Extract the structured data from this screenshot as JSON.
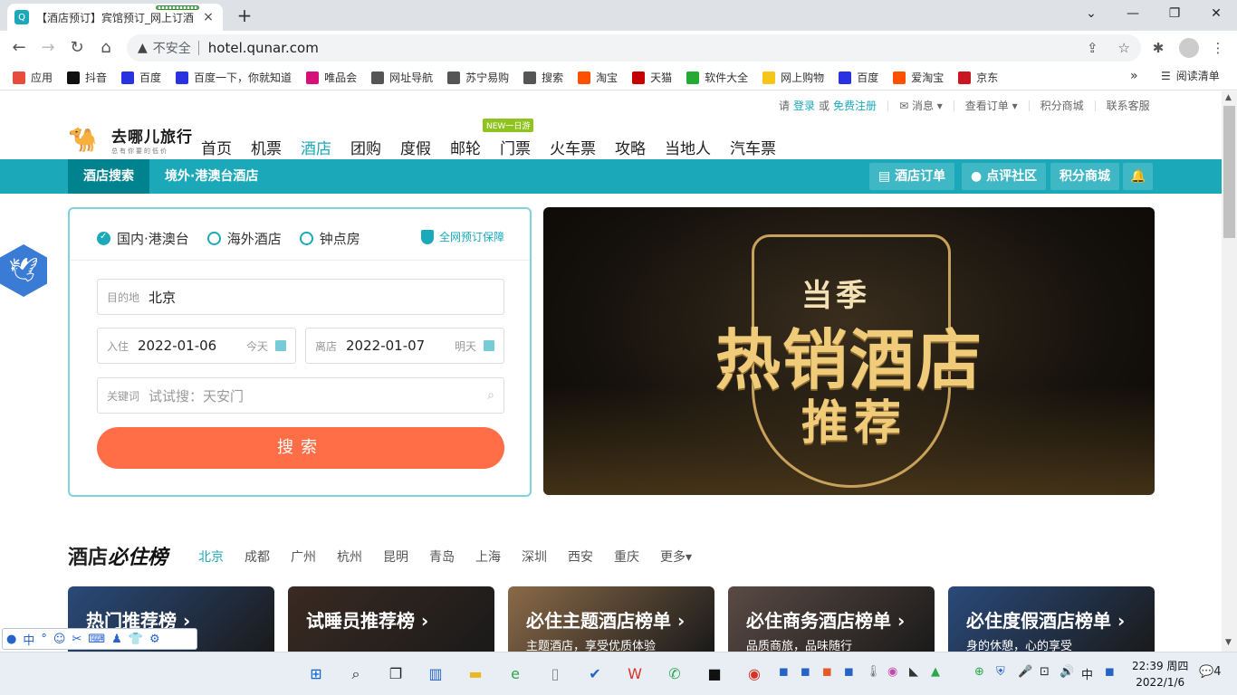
{
  "browser": {
    "tab_title": "【酒店预订】宾馆预订_网上订酒",
    "tab_close": "×",
    "new_tab": "+",
    "win_min": "⌄",
    "win_minimize": "—",
    "win_max": "❐",
    "win_close": "✕",
    "security": "不安全",
    "url": "hotel.qunar.com",
    "bookmarks": [
      {
        "label": "应用",
        "color": "#e74c3c"
      },
      {
        "label": "抖音",
        "color": "#111111"
      },
      {
        "label": "百度",
        "color": "#2932e1"
      },
      {
        "label": "百度一下，你就知道",
        "color": "#2932e1"
      },
      {
        "label": "唯品会",
        "color": "#d6127a"
      },
      {
        "label": "网址导航",
        "color": "#555555"
      },
      {
        "label": "苏宁易购",
        "color": "#555555"
      },
      {
        "label": "搜索",
        "color": "#555555"
      },
      {
        "label": "淘宝",
        "color": "#ff5000"
      },
      {
        "label": "天猫",
        "color": "#c40000"
      },
      {
        "label": "软件大全",
        "color": "#22aa33"
      },
      {
        "label": "网上购物",
        "color": "#f5c518"
      },
      {
        "label": "百度",
        "color": "#2932e1"
      },
      {
        "label": "爱淘宝",
        "color": "#ff5000"
      },
      {
        "label": "京东",
        "color": "#c81623"
      }
    ],
    "bookmarks_more": "»",
    "reading_list": "阅读清单"
  },
  "userbar": {
    "prefix": "请",
    "login": "登录",
    "or": "或",
    "register": "免费注册",
    "messages": "消息",
    "orders": "查看订单",
    "points_mall": "积分商城",
    "service": "联系客服"
  },
  "logo": {
    "name": "去哪儿旅行",
    "slogan": "总有你要的低价"
  },
  "nav": {
    "items": [
      "首页",
      "机票",
      "酒店",
      "团购",
      "度假",
      "邮轮",
      "门票",
      "火车票",
      "攻略",
      "当地人",
      "汽车票"
    ],
    "active_index": 2,
    "badge_new": "NEW",
    "badge_text": "一日游"
  },
  "subnav": {
    "active": "酒店搜索",
    "overseas": "境外·港澳台酒店",
    "right": [
      "酒店订单",
      "点评社区",
      "积分商城"
    ]
  },
  "search": {
    "options": [
      "国内·港澳台",
      "海外酒店",
      "钟点房"
    ],
    "selected_index": 0,
    "guarantee": "全网预订保障",
    "dest_label": "目的地",
    "dest_value": "北京",
    "checkin_label": "入住",
    "checkin_value": "2022-01-06",
    "checkin_hint": "今天",
    "checkout_label": "离店",
    "checkout_value": "2022-01-07",
    "checkout_hint": "明天",
    "keyword_label": "关键词",
    "keyword_placeholder": "试试搜：天安门",
    "button": "搜索"
  },
  "banner": {
    "line1": "当季",
    "line2": "热销酒店",
    "line3": "推荐"
  },
  "ranking": {
    "title_a": "酒店",
    "title_b": "必住榜",
    "cities": [
      "北京",
      "成都",
      "广州",
      "杭州",
      "昆明",
      "青岛",
      "上海",
      "深圳",
      "西安",
      "重庆",
      "更多▾"
    ],
    "active_city_index": 0,
    "cards": [
      {
        "title": "热门推荐榜 ›",
        "sub": "",
        "bg": "#2a4a7a"
      },
      {
        "title": "试睡员推荐榜 ›",
        "sub": "",
        "bg": "#3a2a22"
      },
      {
        "title": "必住主题酒店榜单 ›",
        "sub": "主题酒店，享受优质体验",
        "bg": "#8a6a48"
      },
      {
        "title": "必住商务酒店榜单 ›",
        "sub": "品质商旅，品味随行",
        "bg": "#5a4a44"
      },
      {
        "title": "必住度假酒店榜单 ›",
        "sub": "身的休憩，心的享受",
        "bg": "#2a4a7a"
      }
    ]
  },
  "ime": [
    "中",
    "°",
    "☺",
    "✂",
    "⌨",
    "♟",
    "👕",
    "⚙"
  ],
  "taskbar": {
    "time": "22:39 周四",
    "date": "2022/1/6",
    "lang": "中",
    "notif": "4"
  }
}
